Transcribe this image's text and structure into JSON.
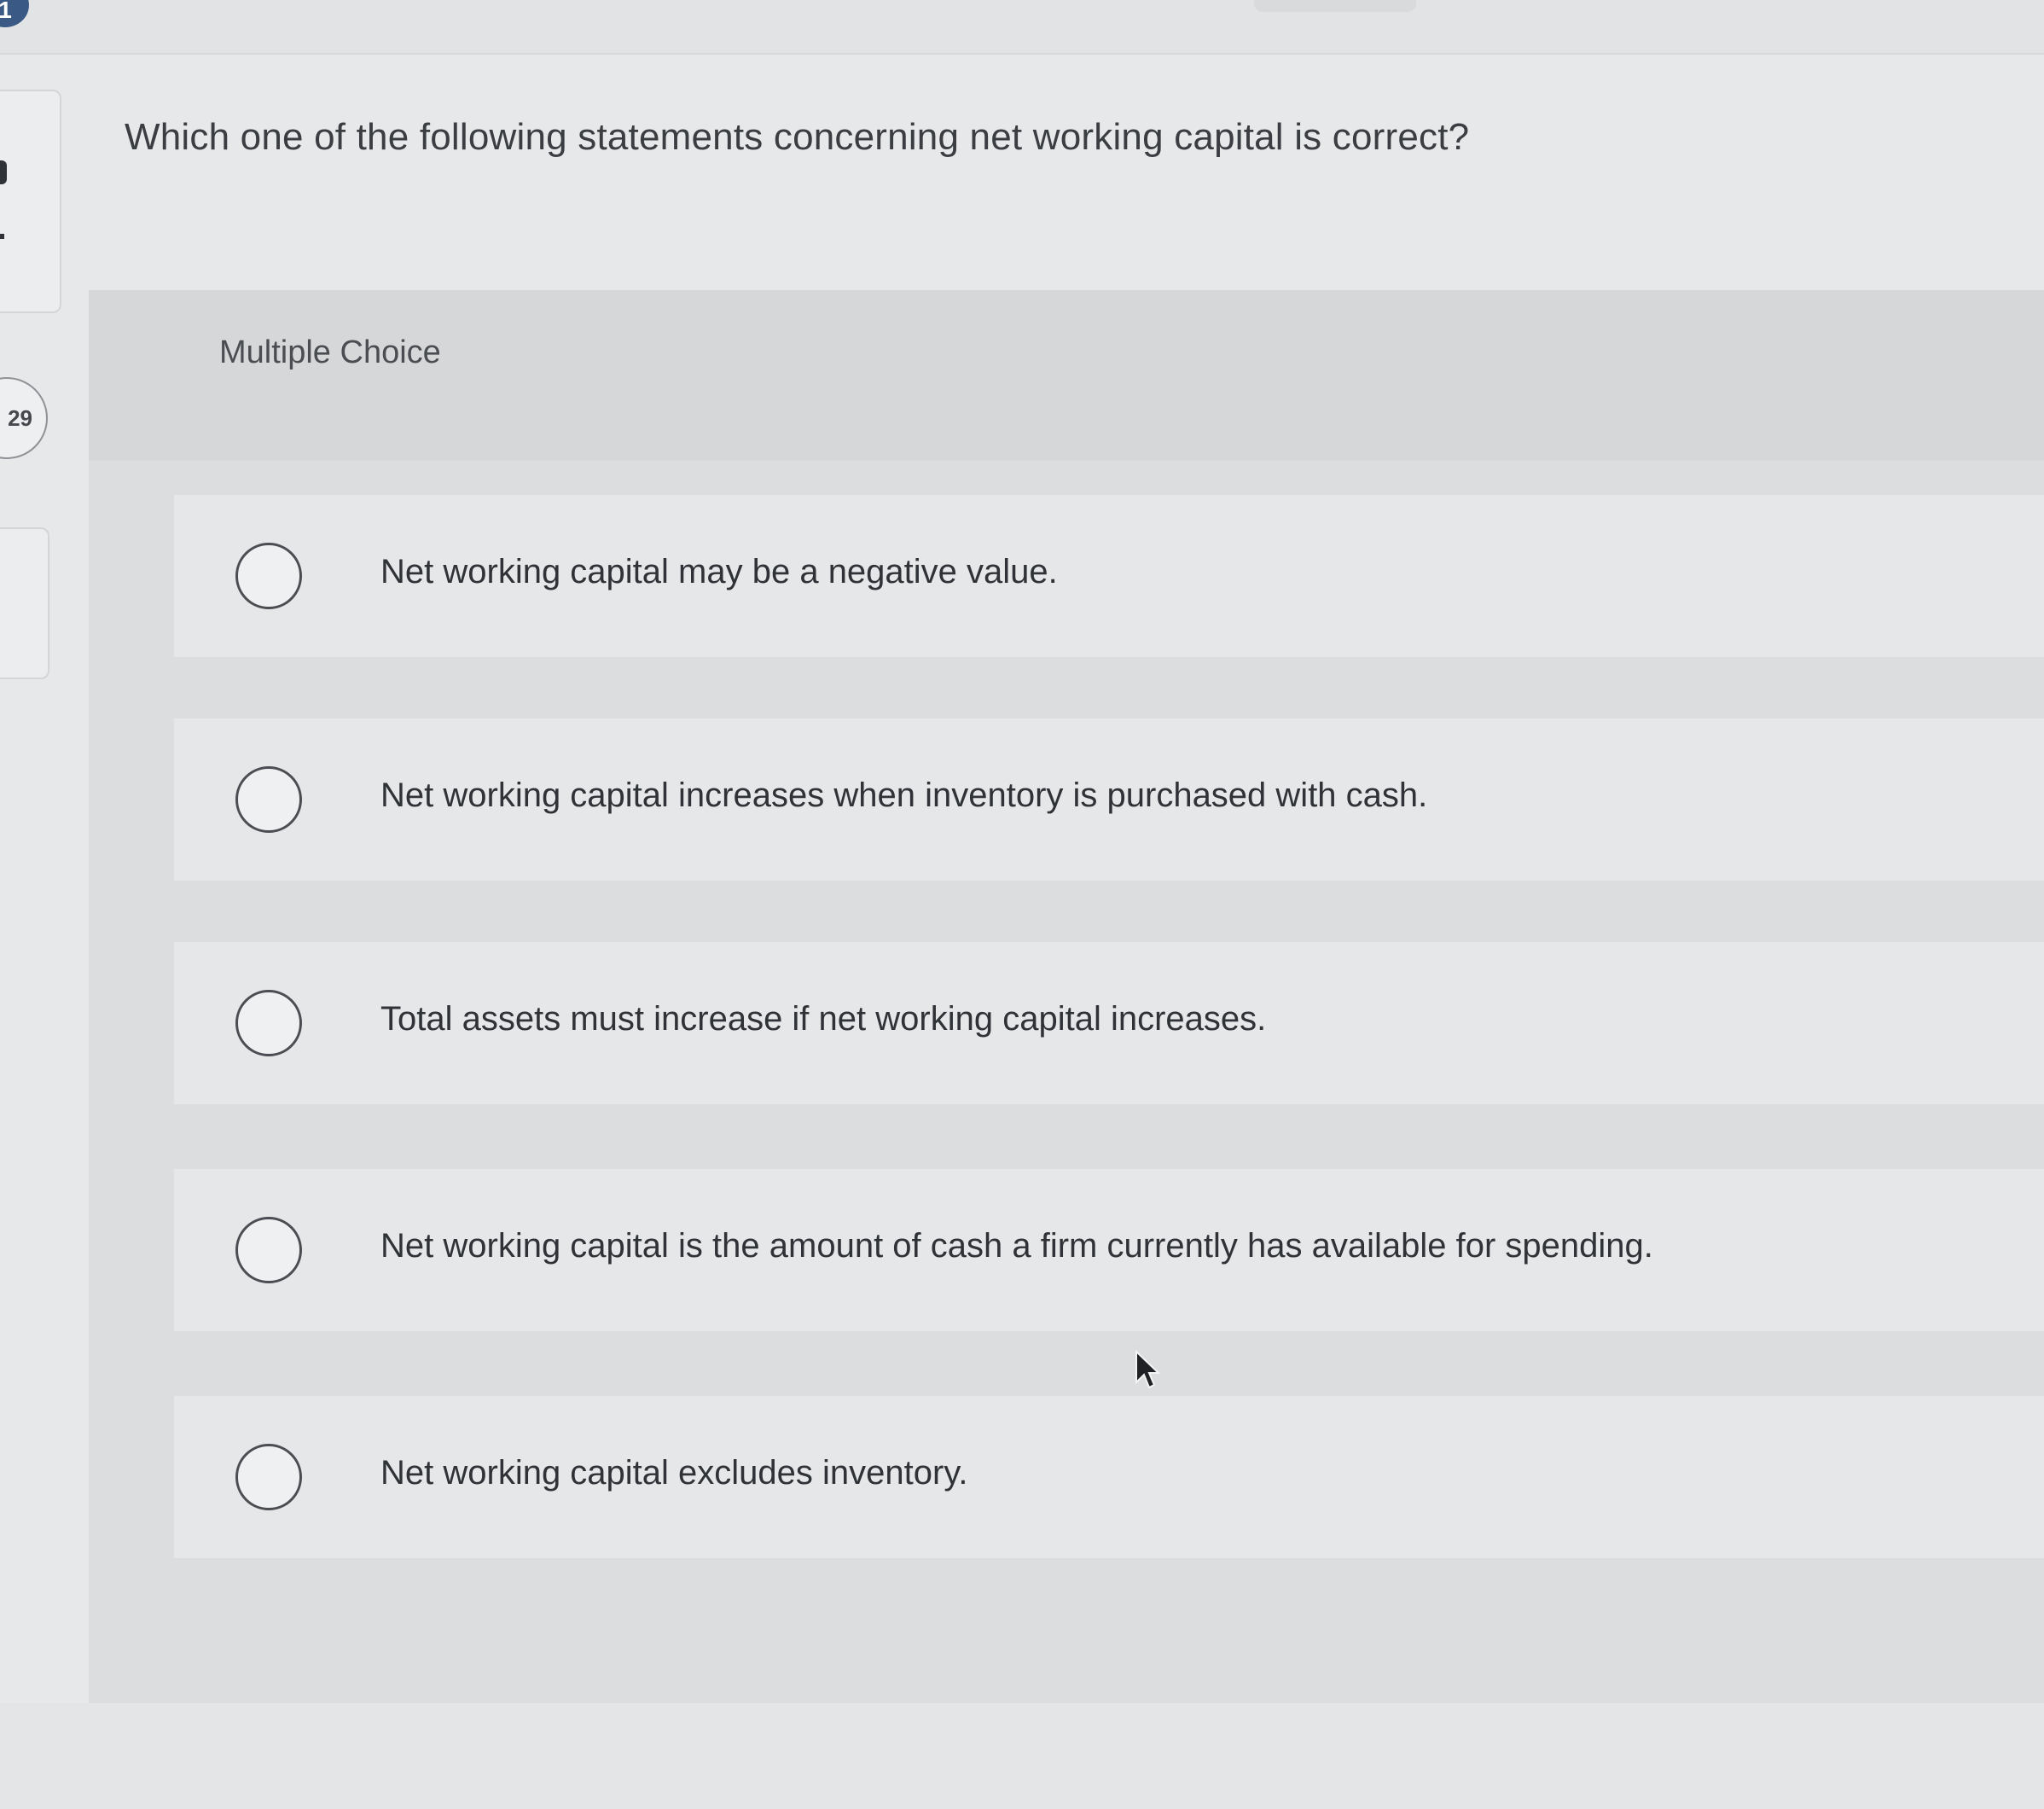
{
  "header": {
    "question_number": "1",
    "points": "29"
  },
  "question": {
    "text": "Which one of the following statements concerning net working capital is correct?",
    "type_label": "Multiple Choice"
  },
  "options": [
    {
      "label": "Net working capital may be a negative value.",
      "selected": false
    },
    {
      "label": "Net working capital increases when inventory is purchased with cash.",
      "selected": false
    },
    {
      "label": "Total assets must increase if net working capital increases.",
      "selected": false
    },
    {
      "label": "Net working capital is the amount of cash a firm currently has available for spending.",
      "selected": false
    },
    {
      "label": "Net working capital excludes inventory.",
      "selected": false
    }
  ],
  "colors": {
    "page_background": "#e7e8e9",
    "panel_background": "#dcdddf",
    "option_background": "#e6e7e9",
    "text": "#2f3236",
    "badge": "#3a5a85"
  }
}
